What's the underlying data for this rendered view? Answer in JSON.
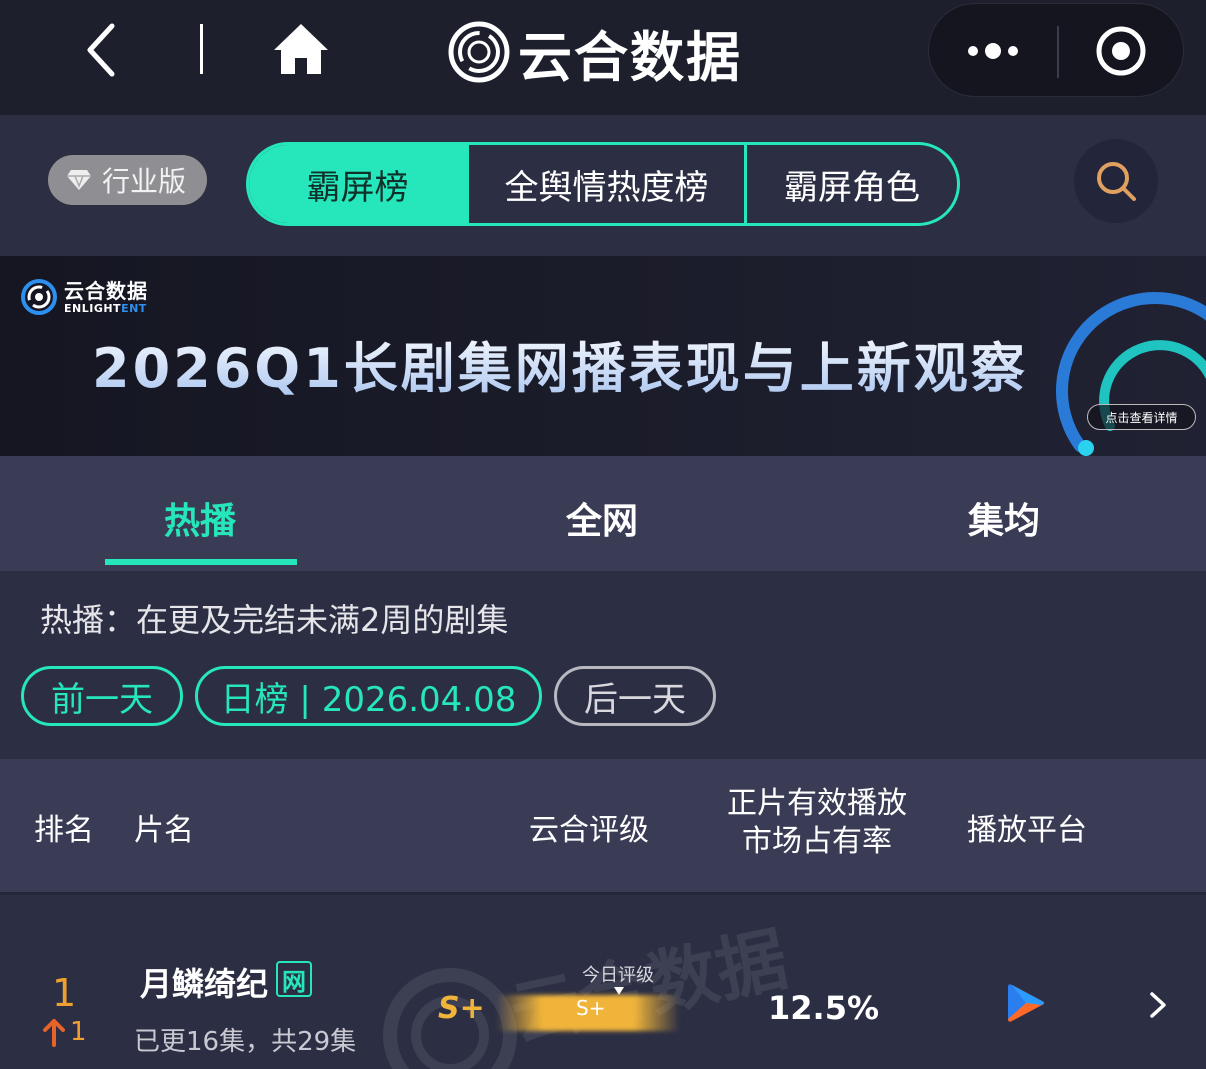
{
  "nav": {
    "brand_name": "云合数据",
    "icons": {
      "back": "chevron-left-icon",
      "home": "home-icon",
      "more": "more-dots-icon",
      "target": "target-icon"
    }
  },
  "switcher": {
    "edition_label": "行业版",
    "tabs": [
      {
        "label": "霸屏榜",
        "active": true
      },
      {
        "label": "全舆情热度榜",
        "active": false
      },
      {
        "label": "霸屏角色",
        "active": false
      }
    ],
    "search_icon": "search-icon"
  },
  "banner": {
    "logo_cn": "云合数据",
    "logo_en_a": "ENLIGHT",
    "logo_en_b": "ENT",
    "title": "2026Q1长剧集网播表现与上新观察",
    "cta": "点击查看详情"
  },
  "categories": [
    {
      "label": "热播",
      "active": true
    },
    {
      "label": "全网",
      "active": false
    },
    {
      "label": "集均",
      "active": false
    }
  ],
  "filter": {
    "description": "热播：在更及完结未满2周的剧集",
    "prev_label": "前一天",
    "date_label": "日榜 | 2026.04.08",
    "next_label": "后一天"
  },
  "table": {
    "headers": {
      "rank": "排名",
      "name": "片名",
      "grade": "云合评级",
      "share": "正片有效播放\n市场占有率",
      "platform": "播放平台"
    },
    "rows": [
      {
        "rank": "1",
        "rank_change": "1",
        "title": "月鳞绮纪",
        "badge": "网",
        "episodes": "已更16集，共29集",
        "grade": "S+",
        "grade_caption": "今日评级",
        "grade_today": "S+",
        "share": "12.5%",
        "platform": "youku-icon"
      }
    ]
  },
  "colors": {
    "accent": "#26e6bb",
    "rank": "#f0a030",
    "grade": "#f0b43a",
    "nav_bg": "#1d1f2c",
    "panel_bg": "#2c2f44",
    "header_bg": "#3a3c55"
  }
}
